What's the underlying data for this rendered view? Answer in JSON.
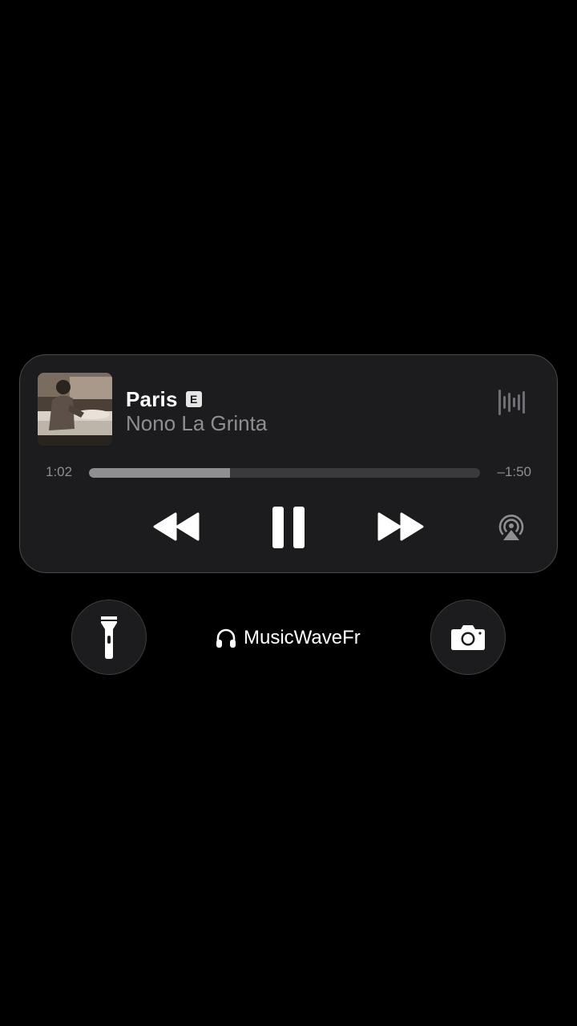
{
  "now_playing": {
    "title": "Paris",
    "explicit_badge": "E",
    "artist": "Nono La Grinta",
    "artwork_icon": "album-artwork",
    "elapsed": "1:02",
    "remaining": "–1:50",
    "progress_percent": 36,
    "controls": {
      "rewind_icon": "backward-icon",
      "pause_icon": "pause-icon",
      "forward_icon": "forward-icon",
      "airplay_icon": "airplay-icon",
      "waveform_icon": "waveform-icon"
    }
  },
  "quick_actions": {
    "flashlight_icon": "flashlight-icon",
    "camera_icon": "camera-icon"
  },
  "output_device": {
    "icon": "headphones-icon",
    "name": "MusicWaveFr"
  },
  "colors": {
    "background": "#000000",
    "card": "#1c1c1e",
    "secondary_text": "#8e8e93",
    "track": "#3a3a3c"
  }
}
